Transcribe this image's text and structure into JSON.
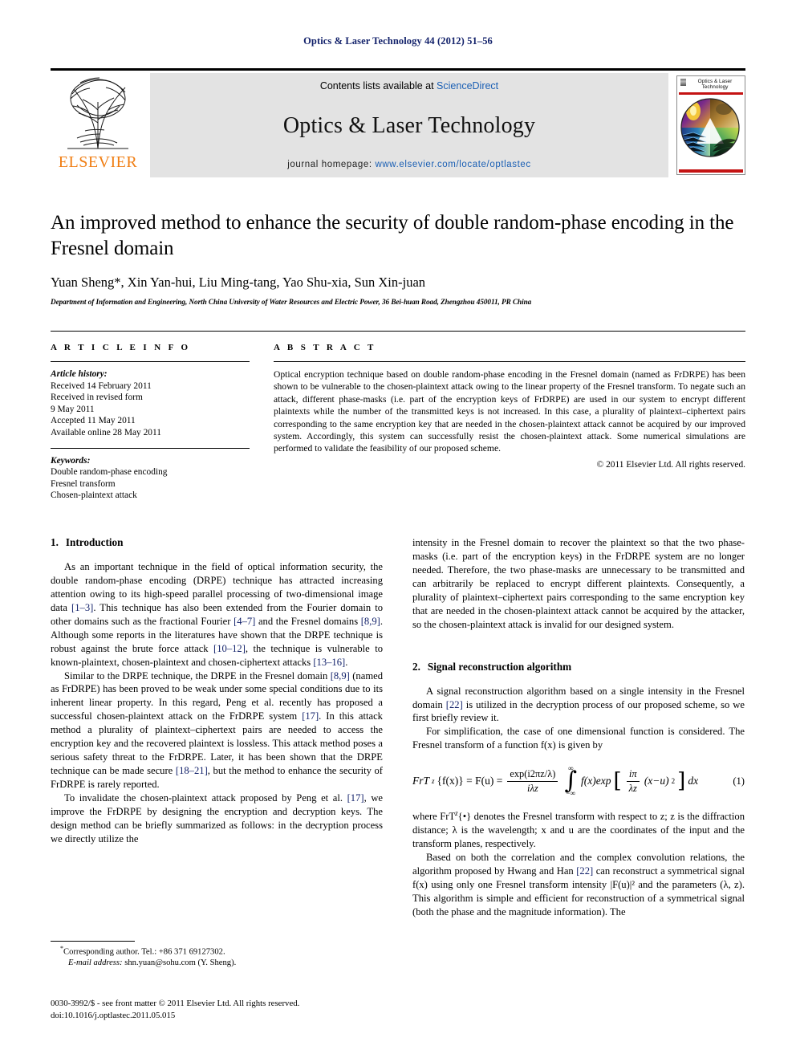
{
  "running_head": "Optics & Laser Technology 44 (2012) 51–56",
  "masthead": {
    "contents_prefix": "Contents lists available at ",
    "contents_link": "ScienceDirect",
    "journal_title": "Optics & Laser Technology",
    "homepage_prefix": "journal homepage: ",
    "homepage_url": "www.elsevier.com/locate/optlastec",
    "publisher": "ELSEVIER",
    "cover_title_line1": "Optics & Laser",
    "cover_title_line2": "Technology",
    "accent_link_color": "#1a5fb4",
    "publisher_color": "#f07e13",
    "cover_rule_color": "#c41313"
  },
  "title": "An improved method to enhance the security of double random-phase encoding in the Fresnel domain",
  "authors": "Yuan Sheng*, Xin Yan-hui, Liu Ming-tang, Yao Shu-xia, Sun Xin-juan",
  "affiliation": "Department of Information and Engineering, North China University of Water Resources and Electric Power, 36 Bei-huan Road, Zhengzhou 450011, PR China",
  "article_info": {
    "heading": "A R T I C L E   I N F O",
    "history_label": "Article history:",
    "history": [
      "Received 14 February 2011",
      "Received in revised form",
      "9 May 2011",
      "Accepted 11 May 2011",
      "Available online 28 May 2011"
    ],
    "keywords_label": "Keywords:",
    "keywords": [
      "Double random-phase encoding",
      "Fresnel transform",
      "Chosen-plaintext attack"
    ]
  },
  "abstract": {
    "heading": "A B S T R A C T",
    "text": "Optical encryption technique based on double random-phase encoding in the Fresnel domain (named as FrDRPE) has been shown to be vulnerable to the chosen-plaintext attack owing to the linear property of the Fresnel transform. To negate such an attack, different phase-masks (i.e. part of the encryption keys of FrDRPE) are used in our system to encrypt different plaintexts while the number of the transmitted keys is not increased. In this case, a plurality of plaintext–ciphertext pairs corresponding to the same encryption key that are needed in the chosen-plaintext attack cannot be acquired by our improved system. Accordingly, this system can successfully resist the chosen-plaintext attack. Some numerical simulations are performed to validate the feasibility of our proposed scheme.",
    "copyright": "© 2011 Elsevier Ltd. All rights reserved."
  },
  "sections": {
    "intro": {
      "number": "1.",
      "title": "Introduction",
      "p1_a": "As an important technique in the field of optical information security, the double random-phase encoding (DRPE) technique has attracted increasing attention owing to its high-speed parallel processing of two-dimensional image data ",
      "p1_ref1": "[1–3]",
      "p1_b": ". This technique has also been extended from the Fourier domain to other domains such as the fractional Fourier ",
      "p1_ref2": "[4–7]",
      "p1_c": " and the Fresnel domains ",
      "p1_ref3": "[8,9]",
      "p1_d": ". Although some reports in the literatures have shown that the DRPE technique is robust against the brute force attack ",
      "p1_ref4": "[10–12]",
      "p1_e": ", the technique is vulnerable to known-plaintext, chosen-plaintext and chosen-ciphertext attacks ",
      "p1_ref5": "[13–16]",
      "p1_f": ".",
      "p2_a": "Similar to the DRPE technique, the DRPE in the Fresnel domain ",
      "p2_ref1": "[8,9]",
      "p2_b": " (named as FrDRPE) has been proved to be weak under some special conditions due to its inherent linear property. In this regard, Peng et al. recently has proposed a successful chosen-plaintext attack on the FrDRPE system ",
      "p2_ref2": "[17]",
      "p2_c": ". In this attack method a plurality of plaintext–ciphertext pairs are needed to access the encryption key and the recovered plaintext is lossless. This attack method poses a serious safety threat to the FrDRPE. Later, it has been shown that the DRPE technique can be made secure ",
      "p2_ref3": "[18–21]",
      "p2_d": ", but the method to enhance the security of FrDRPE is rarely reported.",
      "p3_a": "To invalidate the chosen-plaintext attack proposed by Peng et al. ",
      "p3_ref1": "[17]",
      "p3_b": ", we improve the FrDRPE by designing the encryption and decryption keys. The design method can be briefly summarized as follows: in the decryption process we directly utilize the",
      "p4": "intensity in the Fresnel domain to recover the plaintext so that the two phase-masks (i.e. part of the encryption keys) in the FrDRPE system are no longer needed. Therefore, the two phase-masks are unnecessary to be transmitted and can arbitrarily be replaced to encrypt different plaintexts. Consequently, a plurality of plaintext–ciphertext pairs corresponding to the same encryption key that are needed in the chosen-plaintext attack cannot be acquired by the attacker, so the chosen-plaintext attack is invalid for our designed system."
    },
    "signal": {
      "number": "2.",
      "title": "Signal reconstruction algorithm",
      "p1_a": "A signal reconstruction algorithm based on a single intensity in the Fresnel domain ",
      "p1_ref1": "[22]",
      "p1_b": " is utilized in the decryption process of our proposed scheme, so we first briefly review it.",
      "p2": "For simplification, the case of one dimensional function is considered. The Fresnel transform of a function f(x) is given by",
      "p3_a": "where FrT",
      "p3_b": "{•} denotes the Fresnel transform with respect to z; z is the diffraction distance; λ is the wavelength; x and u are the coordinates of the input and the transform planes, respectively.",
      "p4_a": "Based on both the correlation and the complex convolution relations, the algorithm proposed by Hwang and Han ",
      "p4_ref1": "[22]",
      "p4_b": " can reconstruct a symmetrical signal f(x) using only one Fresnel transform intensity |F(u)|² and the parameters (λ, z). This algorithm is simple and efficient for reconstruction of a symmetrical signal (both the phase and the magnitude information). The"
    }
  },
  "equation_1": {
    "lhs": "FrT",
    "lhs_sup": "z",
    "lhs_arg": "{f(x)} = F(u) =",
    "frac_num": "exp(i2πz/λ)",
    "frac_den": "iλz",
    "int_upper": "∞",
    "int_lower": "−∞",
    "integrand": "f(x)exp",
    "bracket_frac_num": "iπ",
    "bracket_frac_den": "λz",
    "bracket_rest": "(x−u)",
    "bracket_pow": "2",
    "dx": "dx",
    "number": "(1)"
  },
  "footnote": {
    "corresponding": "Corresponding author. Tel.: +86 371 69127302.",
    "email_label": "E-mail address:",
    "email": "shn.yuan@sohu.com (Y. Sheng)."
  },
  "imprint": {
    "line1": "0030-3992/$ - see front matter © 2011 Elsevier Ltd. All rights reserved.",
    "line2": "doi:10.1016/j.optlastec.2011.05.015"
  }
}
